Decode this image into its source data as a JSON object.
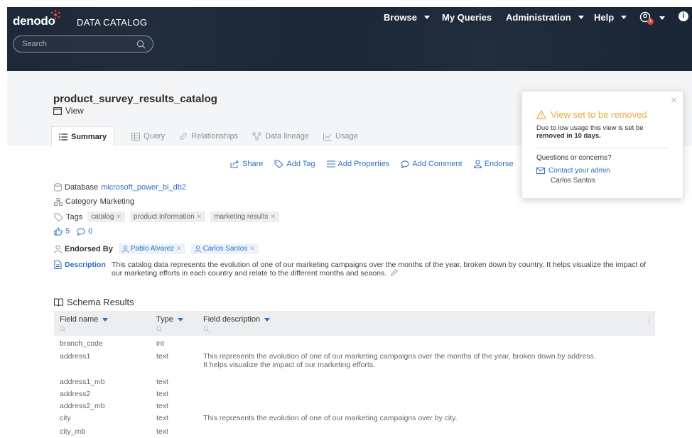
{
  "header": {
    "logo": "denodo",
    "product": "DATA CATALOG",
    "search_placeholder": "Search",
    "nav": [
      {
        "label": "Browse",
        "has_caret": true
      },
      {
        "label": "My Queries",
        "has_caret": false
      },
      {
        "label": "Administration",
        "has_caret": true
      },
      {
        "label": "Help",
        "has_caret": true
      }
    ],
    "notification_count": "1",
    "info_label": "i"
  },
  "page": {
    "title": "product_survey_results_catalog",
    "type": "View",
    "tabs": [
      {
        "label": "Summary",
        "active": true
      },
      {
        "label": "Query"
      },
      {
        "label": "Relationships"
      },
      {
        "label": "Data lineage"
      },
      {
        "label": "Usage"
      }
    ]
  },
  "actions": [
    "Share",
    "Add Tag",
    "Add Properties",
    "Add Comment",
    "Endorse"
  ],
  "meta": {
    "database_label": "Database",
    "database_value": "microsoft_power_bi_db2",
    "category_label": "Category",
    "category_value": "Marketing",
    "tags_label": "Tags",
    "tags": [
      "catalog",
      "product information",
      "marketing results"
    ],
    "likes": "5",
    "comments": "0",
    "endorsed_label": "Endorsed By",
    "endorsers": [
      "Pablo Alvarez",
      "Carlos Santos"
    ],
    "description_label": "Description",
    "description_text": "This catalog data represents the evolution of one of our marketing campaigns over the months of the year, broken down by country. It helps visualize the impact of our marketing efforts in each country and relate to the different months and seaons."
  },
  "schema": {
    "title": "Schema Results",
    "columns": [
      "Field name",
      "Type",
      "Field description"
    ],
    "rows": [
      {
        "name": "branch_code",
        "type": "int",
        "desc": ""
      },
      {
        "name": "address1",
        "type": "text",
        "desc": "This represents the evolution of one of our marketing campaigns over the months of the year, broken down by address.",
        "desc2": "It helps visualize the impact of our marketing efforts."
      },
      {
        "name": "address1_mb",
        "type": "text",
        "desc": ""
      },
      {
        "name": "address2",
        "type": "text",
        "desc": ""
      },
      {
        "name": "address2_mb",
        "type": "text",
        "desc": ""
      },
      {
        "name": "city",
        "type": "text",
        "desc": "This represents the evolution of one of our marketing campaigns over by city."
      },
      {
        "name": "city_mb",
        "type": "text",
        "desc": ""
      }
    ]
  },
  "notice": {
    "title": "View set to be removed",
    "text_prefix": "Due to low usage this view is set be",
    "text_bold": "removed in 10 days.",
    "question": "Questions or concerns?",
    "contact_label": "Contact your admin",
    "admin_name": "Carlos Santos"
  },
  "colors": {
    "header_bg": "#1a2636",
    "link": "#2b6fc9",
    "warning": "#f2a93b"
  }
}
